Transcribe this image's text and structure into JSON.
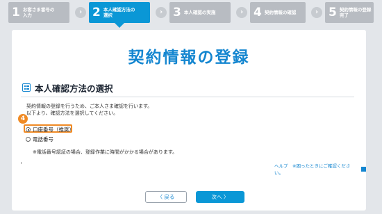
{
  "steps": [
    {
      "num": "1",
      "label": "お客さま番号の\n入力"
    },
    {
      "num": "2",
      "label": "本人確認方法の\n選択"
    },
    {
      "num": "3",
      "label": "本人確認の実施"
    },
    {
      "num": "4",
      "label": "契約情報の確認"
    },
    {
      "num": "5",
      "label": "契約情報の登録\n完了"
    }
  ],
  "active_step": 2,
  "page_title": "契約情報の登録",
  "section_title": "本人確認方法の選択",
  "intro": {
    "line1": "契約情報の登録を行うため、ご本人さま確認を行います。",
    "line2": "以下より、確認方法を選択してください。"
  },
  "badge": "4",
  "options": [
    {
      "label": "口座番号（推奨）",
      "selected": true
    },
    {
      "label": "電話番号",
      "selected": false
    }
  ],
  "note": "※電話番号認証の場合、登録作業に時間がかかる場合があります。",
  "help_link": "ヘルプ　※困ったときにご確認ください。",
  "buttons": {
    "back": "〈 戻る",
    "next": "次へ 〉"
  },
  "colors": {
    "accent": "#0a97d6",
    "highlight": "#f08a24",
    "title": "#1486d0"
  }
}
